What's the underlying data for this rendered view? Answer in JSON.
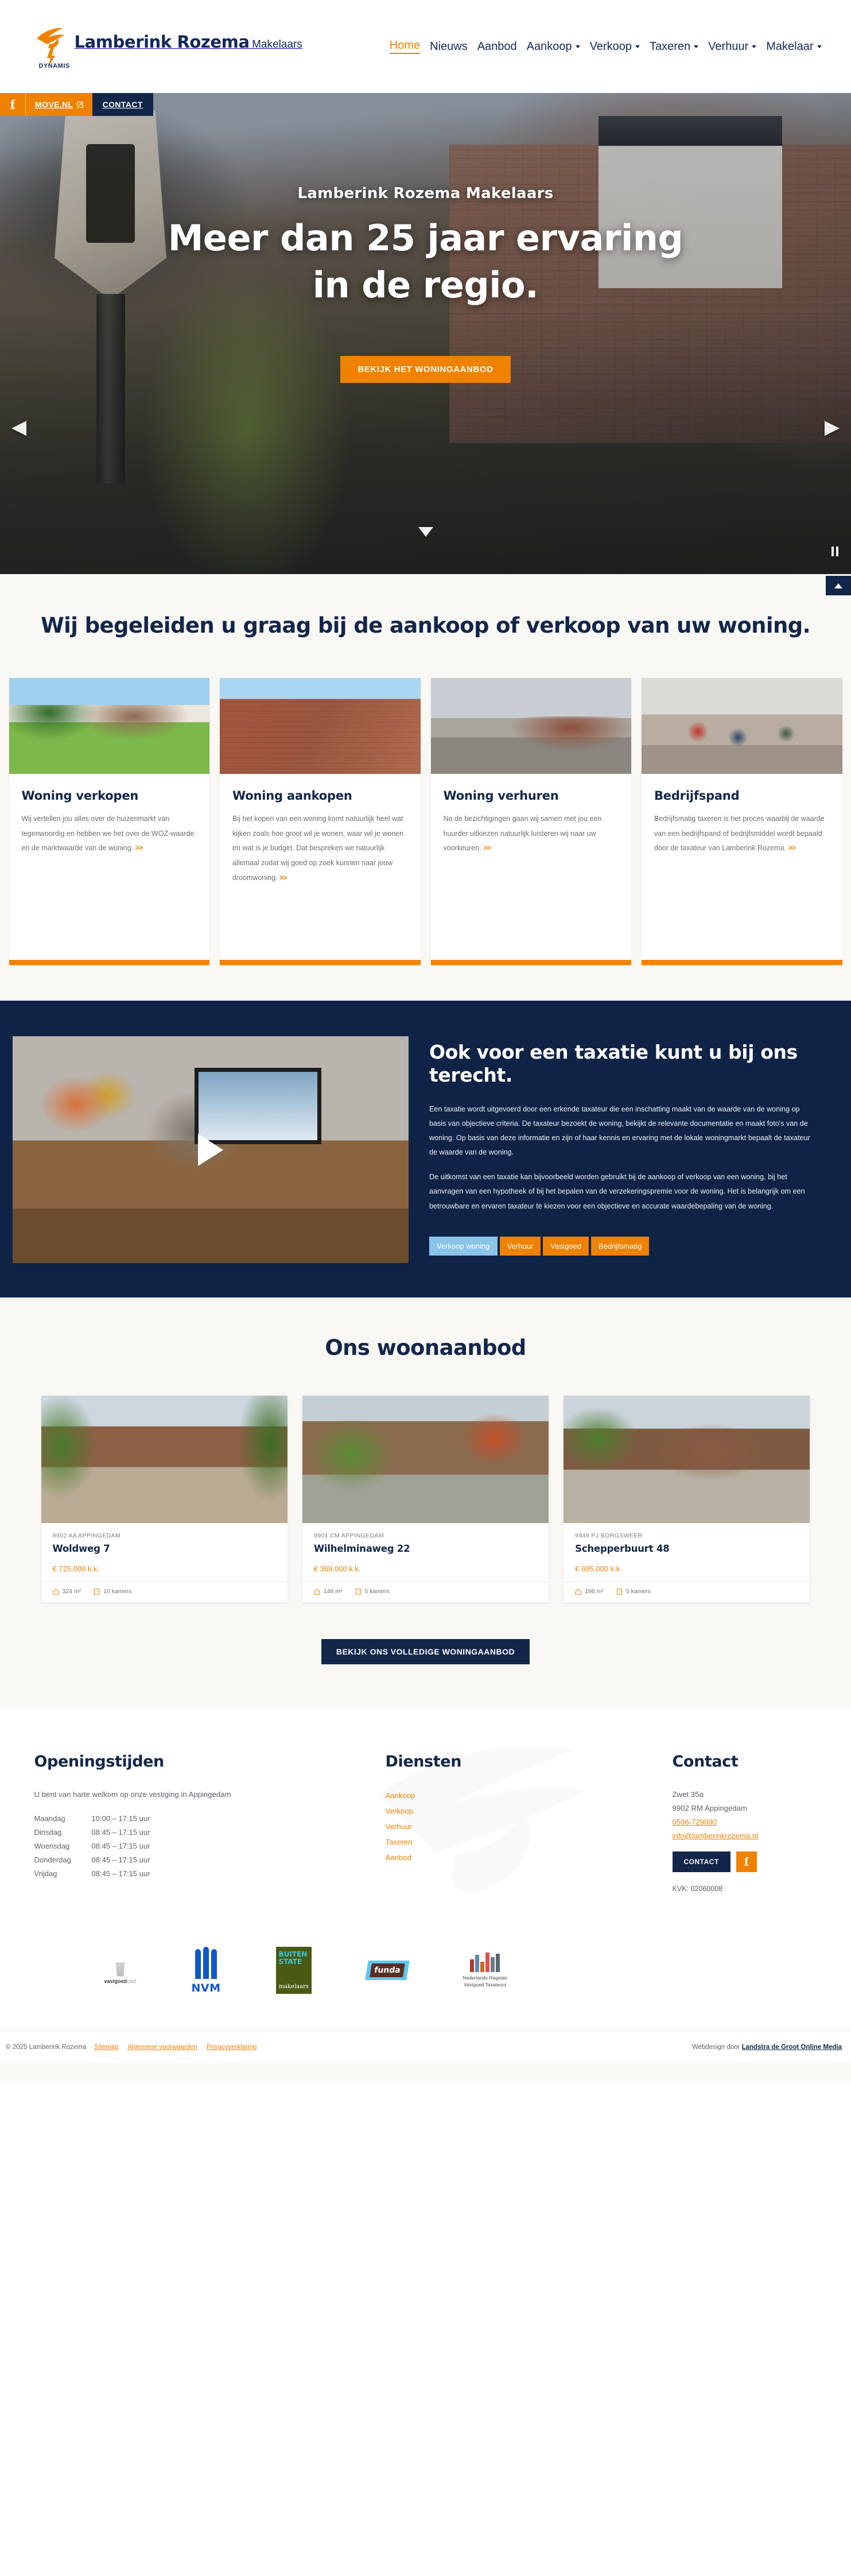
{
  "brand": {
    "name": "Lamberink Rozema",
    "sub": "Makelaars",
    "dynamis": "DYNAMIS"
  },
  "nav": {
    "items": [
      {
        "label": "Home",
        "active": true,
        "caret": false
      },
      {
        "label": "Nieuws",
        "active": false,
        "caret": false
      },
      {
        "label": "Aanbod",
        "active": false,
        "caret": false
      },
      {
        "label": "Aankoop",
        "active": false,
        "caret": true
      },
      {
        "label": "Verkoop",
        "active": false,
        "caret": true
      },
      {
        "label": "Taxeren",
        "active": false,
        "caret": true
      },
      {
        "label": "Verhuur",
        "active": false,
        "caret": true
      },
      {
        "label": "Makelaar",
        "active": false,
        "caret": true
      }
    ]
  },
  "utilbar": {
    "facebook_icon": "facebook-icon",
    "move_label": "MOVE.NL",
    "move_external_icon": "external-link-icon",
    "contact_label": "CONTACT"
  },
  "hero": {
    "kicker": "Lamberink Rozema Makelaars",
    "title_line1": "Meer dan 25 jaar ervaring",
    "title_line2": "in de regio.",
    "cta": "BEKIJK HET WONINGAANBOD",
    "prev_icon": "chevron-left-icon",
    "next_icon": "chevron-right-icon",
    "scroll_icon": "chevron-down-icon",
    "pause_icon": "pause-icon"
  },
  "scrolltop": {
    "icon": "chevron-up-icon"
  },
  "services": {
    "title": "Wij begeleiden u graag bij de aankoop of verkoop van uw woning.",
    "cards": [
      {
        "title": "Woning verkopen",
        "text": "Wij vertellen jou alles over de huizenmarkt van tegenwoordig en hebben we het over de WOZ-waarde en de marktwaarde van de woning.",
        "more": ">>",
        "image_name": "thatched-house-photo"
      },
      {
        "title": "Woning aankopen",
        "text": "Bij het kopen van een woning komt natuurlijk heel wat kijken zoals hoe groot wil je wonen, waar wil je wonen en wat is je budget. Dat bespreken we natuurlijk allemaal zodat wij goed op zoek kunnen naar jouw droomwoning.",
        "more": ">>",
        "image_name": "brick-townhouse-photo"
      },
      {
        "title": "Woning verhuren",
        "text": "Na de bezichtigingen gaan wij samen met jou een huurder uitkiezen natuurlijk luisteren wij naar uw voorkeuren.",
        "more": ">>",
        "image_name": "new-build-street-photo"
      },
      {
        "title": "Bedrijfspand",
        "text": "Bedrijfsmatig taxeren is het proces waarbij de waarde van een bedrijfspand of bedrijfsmiddel wordt bepaald door de taxateur van Lamberink Rozema.",
        "more": ">>",
        "image_name": "busy-shopping-street-photo"
      }
    ]
  },
  "taxatie": {
    "video_name": "office-meeting-video",
    "play_icon": "play-icon",
    "title": "Ook voor een taxatie kunt u bij ons terecht.",
    "paragraph1": "Een taxatie wordt uitgevoerd door een erkende taxateur die een inschatting maakt van de waarde van de woning op basis van objectieve criteria. De taxateur bezoekt de woning, bekijkt de relevante documentatie en maakt foto's van de woning. Op basis van deze informatie en zijn of haar kennis en ervaring met de lokale woningmarkt bepaalt de taxateur de waarde van de woning.",
    "paragraph2": "De uitkomst van een taxatie kan bijvoorbeeld worden gebruikt bij de aankoop of verkoop van een woning, bij het aanvragen van een hypotheek of bij het bepalen van de verzekeringspremie voor de woning. Het is belangrijk om een betrouwbare en ervaren taxateur te kiezen voor een objectieve en accurate waardebepaling van de woning.",
    "tabs": [
      {
        "label": "Verkoop woning",
        "selected": true
      },
      {
        "label": "Verhuur",
        "selected": false
      },
      {
        "label": "Vastgoed",
        "selected": false
      },
      {
        "label": "Bedrijfsmatig",
        "selected": false
      }
    ]
  },
  "aanbod": {
    "title": "Ons woonaanbod",
    "cta": "BEKIJK ONS VOLLEDIGE WONINGAANBOD",
    "properties": [
      {
        "zip": "9902 AA  APPINGEDAM",
        "address": "Woldweg 7",
        "price": "€ 725.000 k.k.",
        "area": "324 m²",
        "rooms": "10 kamers",
        "image_name": "woldweg-7-photo"
      },
      {
        "zip": "9901 CM  APPINGEDAM",
        "address": "Wilhelminaweg 22",
        "price": "€ 369.000 k.k.",
        "area": "146 m²",
        "rooms": "5 kamers",
        "image_name": "wilhelminaweg-22-photo"
      },
      {
        "zip": "9949 PJ  BORGSWEER",
        "address": "Schepperbuurt 48",
        "price": "€ 695.000 k.k.",
        "area": "198 m²",
        "rooms": "5 kamers",
        "image_name": "schepperbuurt-48-photo"
      }
    ]
  },
  "footer": {
    "hours": {
      "heading": "Openingstijden",
      "intro": "U bent van harte welkom op onze vestiging in Appingedam",
      "rows": [
        {
          "day": "Maandag",
          "time": "10:00 – 17:15 uur"
        },
        {
          "day": "Dinsdag",
          "time": "08:45 – 17:15 uur"
        },
        {
          "day": "Woensdag",
          "time": "08:45 – 17:15 uur"
        },
        {
          "day": "Donderdag",
          "time": "08:45 – 17:15 uur"
        },
        {
          "day": "Vrijdag",
          "time": "08:45 – 17:15 uur"
        }
      ]
    },
    "services": {
      "heading": "Diensten",
      "links": [
        "Aankoop",
        "Verkoop",
        "Verhuur",
        "Taxeren",
        "Aanbod"
      ]
    },
    "contact": {
      "heading": "Contact",
      "street": "Zwet 35a",
      "city": "9902 RM Appingedam",
      "phone": "0596-729090",
      "email": "info@lamberinkrozema.nl",
      "button": "CONTACT",
      "facebook_icon": "facebook-icon",
      "kvk": "KVK: 02060008"
    },
    "partners": [
      {
        "name": "vastgoedcert",
        "label_bold": "vastgoed",
        "label_light": "cert"
      },
      {
        "name": "NVM",
        "label": "NVM"
      },
      {
        "name": "Buiten State makelaars",
        "line1": "BUITEN",
        "line2": "STATE",
        "line3": "makelaars"
      },
      {
        "name": "funda",
        "label": "funda"
      },
      {
        "name": "Nederlands Register Vastgoed Taxateurs",
        "line1": "Nederlands Register",
        "line2": "Vastgoed Taxateurs"
      }
    ],
    "copyright": "© 2025 Lamberink Rozema",
    "copylinks": [
      "Sitemap",
      "Algemene voorwaarden",
      "Privacyverklaring"
    ],
    "webdesign_prefix": "Webdesign door ",
    "webdesign_name": "Landstra de Groot Online Media"
  },
  "colors": {
    "orange": "#ef8200",
    "navy": "#12264a",
    "lightblue": "#8bc4e8",
    "cream": "#faf8f5"
  }
}
